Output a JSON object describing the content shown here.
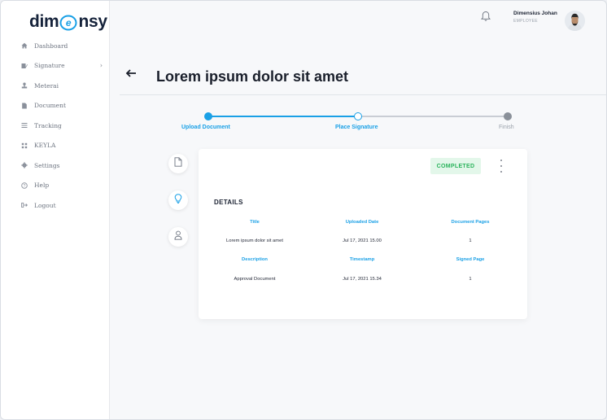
{
  "brand": {
    "logo_left": "dim",
    "logo_right": "nsy"
  },
  "sidebar": {
    "items": [
      {
        "label": "Dashboard",
        "icon": "home-icon"
      },
      {
        "label": "Signature",
        "icon": "signature-icon",
        "has_submenu": true
      },
      {
        "label": "Meterai",
        "icon": "stamp-icon"
      },
      {
        "label": "Document",
        "icon": "document-icon"
      },
      {
        "label": "Tracking",
        "icon": "list-icon"
      },
      {
        "label": "KEYLA",
        "icon": "grid-icon"
      },
      {
        "label": "Settings",
        "icon": "gear-icon"
      },
      {
        "label": "Help",
        "icon": "help-icon"
      },
      {
        "label": "Logout",
        "icon": "logout-icon"
      }
    ]
  },
  "header": {
    "user_name": "Dimensius Johan",
    "user_role": "EMPLOYEE"
  },
  "page": {
    "title": "Lorem ipsum dolor sit amet"
  },
  "stepper": {
    "steps": [
      {
        "label": "Upload Document",
        "state": "done"
      },
      {
        "label": "Place Signature",
        "state": "current"
      },
      {
        "label": "Finish",
        "state": "pending"
      }
    ]
  },
  "card": {
    "status": "COMPLETED",
    "section_title": "DETAILS",
    "row1_headers": [
      "Title",
      "Uploaded Date",
      "Document Pages"
    ],
    "row1_values": [
      "Lorem ipsum dolor sit amet",
      "Jul 17, 2021 15.00",
      "1"
    ],
    "row2_headers": [
      "Description",
      "Timestamp",
      "Signed Page"
    ],
    "row2_values": [
      "Approval Document",
      "Jul 17, 2021 15.34",
      "1"
    ]
  },
  "colors": {
    "accent": "#1aa0e6",
    "success": "#29b35b",
    "success_bg": "#e3f7ea"
  }
}
